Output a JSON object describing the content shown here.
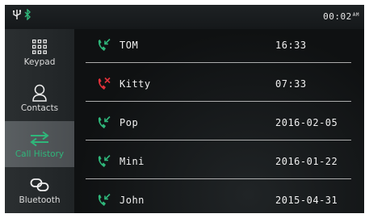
{
  "status": {
    "icons": [
      "usb-icon",
      "bluetooth-icon"
    ],
    "time": "00:02",
    "ampm": "AM"
  },
  "sidebar": {
    "items": [
      {
        "label": "Keypad",
        "icon": "keypad-icon"
      },
      {
        "label": "Contacts",
        "icon": "contacts-icon"
      },
      {
        "label": "Call History",
        "icon": "call-history-icon",
        "active": true
      },
      {
        "label": "Bluetooth",
        "icon": "bluetooth-link-icon"
      }
    ]
  },
  "calls": [
    {
      "name": "TOM",
      "time": "16:33",
      "type": "received",
      "icon": "received-call-icon"
    },
    {
      "name": "Kitty",
      "time": "07:33",
      "type": "missed",
      "icon": "missed-call-icon"
    },
    {
      "name": "Pop",
      "time": "2016-02-05",
      "type": "received",
      "icon": "received-call-icon"
    },
    {
      "name": "Mini",
      "time": "2016-01-22",
      "type": "received",
      "icon": "received-call-icon"
    },
    {
      "name": "John",
      "time": "2015-04-31",
      "type": "received",
      "icon": "received-call-icon"
    }
  ],
  "colors": {
    "accent": "#2fb67a",
    "missed": "#e0313a",
    "text": "#f0f0f0"
  }
}
